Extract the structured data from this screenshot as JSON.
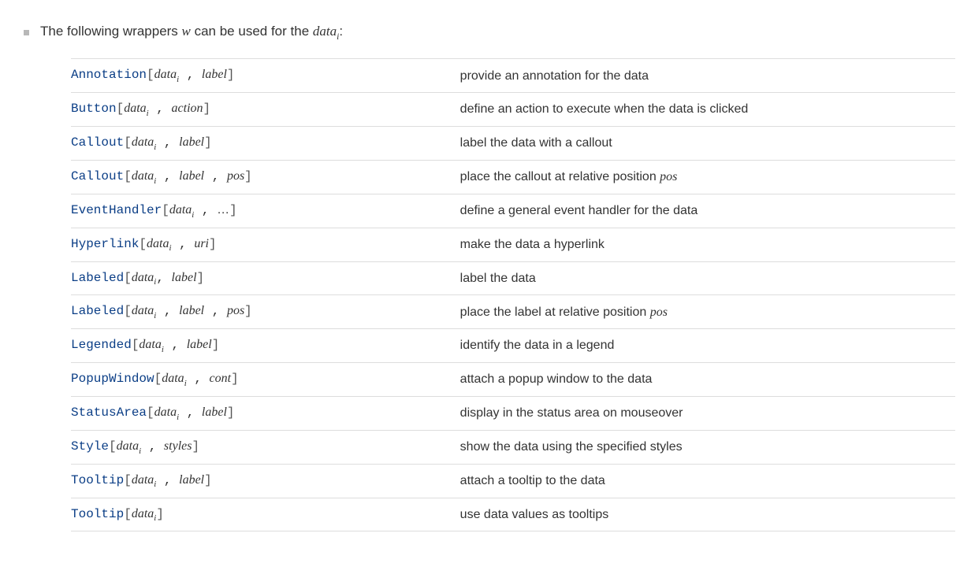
{
  "heading": {
    "prefix": "The following wrappers ",
    "wvar": "w",
    "mid": " can be used for the ",
    "datavar": "data",
    "sub": "i",
    "suffix": ":"
  },
  "common": {
    "lbrack": "[",
    "rbrack": "]",
    "comma": ",",
    "space_after_comma": " ",
    "data_arg": "data",
    "data_sub": "i",
    "ellipsis": "…"
  },
  "rows": [
    {
      "fn": "Annotation",
      "extra_args": [
        {
          "kind": "arg",
          "text": "label"
        }
      ],
      "desc_before": "provide an annotation for the data",
      "desc_pos": "",
      "desc_after": ""
    },
    {
      "fn": "Button",
      "extra_args": [
        {
          "kind": "arg",
          "text": "action"
        }
      ],
      "desc_before": "define an action to execute when the data is clicked",
      "desc_pos": "",
      "desc_after": ""
    },
    {
      "fn": "Callout",
      "extra_args": [
        {
          "kind": "arg",
          "text": "label"
        }
      ],
      "desc_before": "label the data with a callout",
      "desc_pos": "",
      "desc_after": ""
    },
    {
      "fn": "Callout",
      "extra_args": [
        {
          "kind": "arg",
          "text": "label"
        },
        {
          "kind": "arg",
          "text": "pos"
        }
      ],
      "desc_before": "place the callout at relative position ",
      "desc_pos": "pos",
      "desc_after": ""
    },
    {
      "fn": "EventHandler",
      "extra_args": [
        {
          "kind": "ellipsis"
        }
      ],
      "desc_before": "define a general event handler for the data",
      "desc_pos": "",
      "desc_after": ""
    },
    {
      "fn": "Hyperlink",
      "extra_args": [
        {
          "kind": "arg",
          "text": "uri"
        }
      ],
      "desc_before": "make the data a hyperlink",
      "desc_pos": "",
      "desc_after": ""
    },
    {
      "fn": "Labeled",
      "comma_kind": "tight",
      "extra_args": [
        {
          "kind": "arg",
          "text": "label"
        }
      ],
      "desc_before": "label the data",
      "desc_pos": "",
      "desc_after": ""
    },
    {
      "fn": "Labeled",
      "extra_args": [
        {
          "kind": "arg",
          "text": "label"
        },
        {
          "kind": "arg",
          "text": "pos"
        }
      ],
      "desc_before": "place the label at relative position ",
      "desc_pos": "pos",
      "desc_after": ""
    },
    {
      "fn": "Legended",
      "extra_args": [
        {
          "kind": "arg",
          "text": "label"
        }
      ],
      "desc_before": "identify the data in a legend",
      "desc_pos": "",
      "desc_after": ""
    },
    {
      "fn": "PopupWindow",
      "extra_args": [
        {
          "kind": "arg",
          "text": "cont"
        }
      ],
      "desc_before": "attach a popup window to the data",
      "desc_pos": "",
      "desc_after": ""
    },
    {
      "fn": "StatusArea",
      "extra_args": [
        {
          "kind": "arg",
          "text": "label"
        }
      ],
      "desc_before": "display in the status area on mouseover",
      "desc_pos": "",
      "desc_after": ""
    },
    {
      "fn": "Style",
      "extra_args": [
        {
          "kind": "arg",
          "text": "styles"
        }
      ],
      "desc_before": "show the data using the specified styles",
      "desc_pos": "",
      "desc_after": ""
    },
    {
      "fn": "Tooltip",
      "extra_args": [
        {
          "kind": "arg",
          "text": "label"
        }
      ],
      "desc_before": "attach a tooltip to the data",
      "desc_pos": "",
      "desc_after": ""
    },
    {
      "fn": "Tooltip",
      "extra_args": [],
      "desc_before": "use data values as tooltips",
      "desc_pos": "",
      "desc_after": ""
    }
  ]
}
